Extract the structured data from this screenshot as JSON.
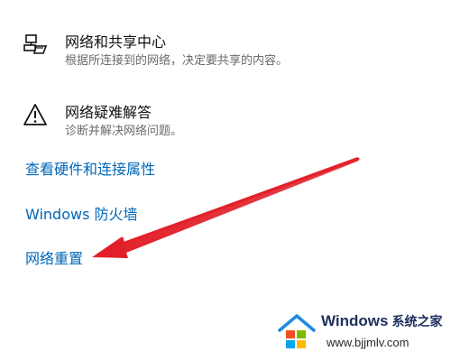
{
  "items": [
    {
      "icon": "network-sharing-icon",
      "title": "网络和共享中心",
      "desc": "根据所连接到的网络，决定要共享的内容。"
    },
    {
      "icon": "warning-icon",
      "title": "网络疑难解答",
      "desc": "诊断并解决网络问题。"
    }
  ],
  "links": {
    "hardware": "查看硬件和连接属性",
    "firewall": "Windows 防火墙",
    "reset": "网络重置"
  },
  "annotation": {
    "arrow_color": "#e2202a",
    "arrow_target": "网络重置"
  },
  "watermark": {
    "brand": "Windows",
    "brand_cn": "系统之家",
    "url": "www.bjjmlv.com",
    "logo_colors": [
      "#f25022",
      "#7fba00",
      "#00a4ef",
      "#ffb900"
    ]
  },
  "colors": {
    "link": "#0067b8",
    "title": "#111111",
    "desc": "#6b6b6b"
  }
}
